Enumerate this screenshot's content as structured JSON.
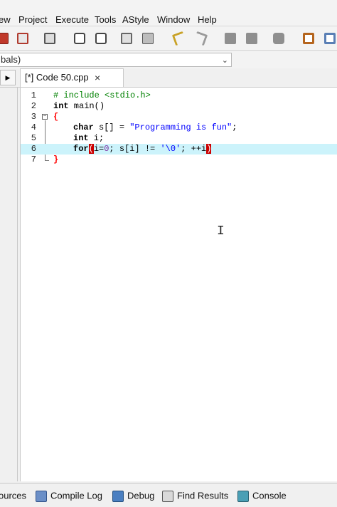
{
  "menu": {
    "items": [
      "ew",
      "Project",
      "Execute",
      "Tools",
      "AStyle",
      "Window",
      "Help"
    ]
  },
  "toolbar": {
    "icons": [
      "close-file-icon",
      "close-all-icon",
      "print-icon",
      "find-icon",
      "replace-icon",
      "goto-icon",
      "bookmark-icon",
      "undo-icon",
      "redo-icon",
      "indent-icon",
      "unindent-icon",
      "toggle-comment-icon",
      "new-class-icon",
      "debug-icon"
    ]
  },
  "scope": {
    "value": "bals)"
  },
  "editor": {
    "tab_label": "[*] Code 50.cpp",
    "tab_close": "×",
    "line_numbers": [
      "1",
      "2",
      "3",
      "4",
      "5",
      "6",
      "7"
    ],
    "line1": "# include <stdio.h>",
    "line2_kw": "int",
    "line2_rest": " main()",
    "line3": "{",
    "line4_kw": "char",
    "line4_mid": " s[] = ",
    "line4_str": "\"Programming is fun\"",
    "line4_end": ";",
    "line5_kw": "int",
    "line5_rest": " i;",
    "line6_kw": "for",
    "line6_open": "(",
    "line6_a": "i=",
    "line6_n": "0",
    "line6_b": "; s[i] != ",
    "line6_s": "'\\0'",
    "line6_c": "; ++i",
    "line6_close": ")",
    "line7": "}",
    "cursor_glyph": "I"
  },
  "bottom_tabs": {
    "resources": "ources",
    "compile_log": "Compile Log",
    "debug": "Debug",
    "find_results": "Find Results",
    "console": "Console"
  },
  "colors": {
    "active_line": "#ccf3fb",
    "keyword": "#000000",
    "string": "#0000ff",
    "preprocessor": "#008000",
    "number": "#7a2fa0",
    "brace_match": "#cc0000"
  }
}
